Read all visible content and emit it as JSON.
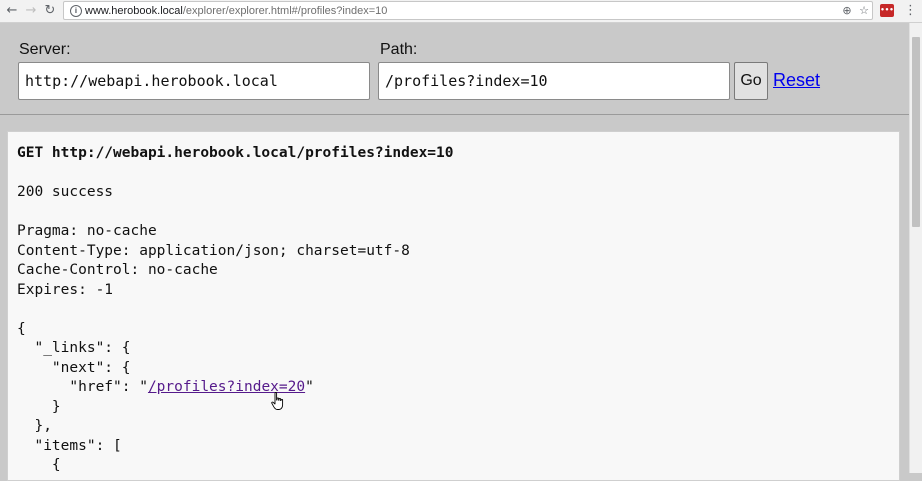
{
  "browser": {
    "url_host": "www.herobook.local",
    "url_rest": "/explorer/explorer.html#/profiles?index=10",
    "back_icon": "back-arrow-icon",
    "forward_icon": "forward-arrow-icon",
    "reload_icon": "reload-icon",
    "ext_label": "•••"
  },
  "explorer": {
    "server_label": "Server:",
    "server_value": "http://webapi.herobook.local",
    "path_label": "Path:",
    "path_value": "/profiles?index=10",
    "go_label": "Go",
    "reset_label": "Reset"
  },
  "response": {
    "request_line": "GET http://webapi.herobook.local/profiles?index=10",
    "status": "200 success",
    "headers": [
      "Pragma: no-cache",
      "Content-Type: application/json; charset=utf-8",
      "Cache-Control: no-cache",
      "Expires: -1"
    ],
    "body": {
      "l1": "{",
      "l2": "  \"_links\": {",
      "l3": "    \"next\": {",
      "l4_prefix": "      \"href\": \"",
      "next_href": "/profiles?index=20",
      "l4_suffix": "\"",
      "l5": "    }",
      "l6": "  },",
      "l7": "  \"items\": [",
      "l8": "    {"
    }
  },
  "colors": {
    "link": "#0000ee",
    "visited_link": "#551a8b",
    "header_bg": "#c9c9c9",
    "panel_bg": "#f8f8f8"
  }
}
